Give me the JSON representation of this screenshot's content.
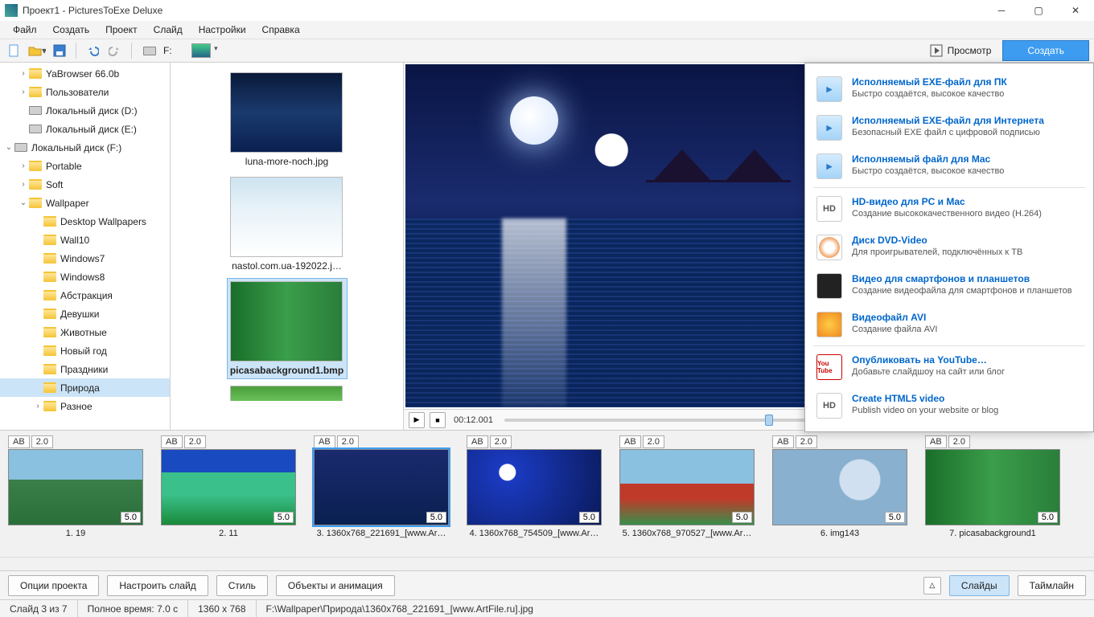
{
  "title": "Проект1 - PicturesToExe Deluxe",
  "menu": [
    "Файл",
    "Создать",
    "Проект",
    "Слайд",
    "Настройки",
    "Справка"
  ],
  "toolbar": {
    "drive_label": "F:",
    "preview": "Просмотр",
    "create": "Создать"
  },
  "tree": [
    {
      "indent": 1,
      "twisty": ">",
      "icon": "folder",
      "label": "YaBrowser 66.0b"
    },
    {
      "indent": 1,
      "twisty": ">",
      "icon": "folder",
      "label": "Пользователи"
    },
    {
      "indent": 1,
      "twisty": "",
      "icon": "drive",
      "label": "Локальный диск (D:)"
    },
    {
      "indent": 1,
      "twisty": "",
      "icon": "drive",
      "label": "Локальный диск (E:)"
    },
    {
      "indent": 0,
      "twisty": "v",
      "icon": "drive",
      "label": "Локальный диск (F:)"
    },
    {
      "indent": 1,
      "twisty": ">",
      "icon": "folder",
      "label": "Portable"
    },
    {
      "indent": 1,
      "twisty": ">",
      "icon": "folder",
      "label": "Soft"
    },
    {
      "indent": 1,
      "twisty": "v",
      "icon": "folder",
      "label": "Wallpaper"
    },
    {
      "indent": 2,
      "twisty": "",
      "icon": "folder",
      "label": "Desktop Wallpapers"
    },
    {
      "indent": 2,
      "twisty": "",
      "icon": "folder",
      "label": "Wall10"
    },
    {
      "indent": 2,
      "twisty": "",
      "icon": "folder",
      "label": "Windows7"
    },
    {
      "indent": 2,
      "twisty": "",
      "icon": "folder",
      "label": "Windows8"
    },
    {
      "indent": 2,
      "twisty": "",
      "icon": "folder",
      "label": "Абстракция"
    },
    {
      "indent": 2,
      "twisty": "",
      "icon": "folder",
      "label": "Девушки"
    },
    {
      "indent": 2,
      "twisty": "",
      "icon": "folder",
      "label": "Животные"
    },
    {
      "indent": 2,
      "twisty": "",
      "icon": "folder",
      "label": "Новый год"
    },
    {
      "indent": 2,
      "twisty": "",
      "icon": "folder",
      "label": "Праздники"
    },
    {
      "indent": 2,
      "twisty": "",
      "icon": "folder",
      "label": "Природа",
      "selected": true
    },
    {
      "indent": 2,
      "twisty": ">",
      "icon": "folder",
      "label": "Разное"
    }
  ],
  "thumbs": [
    {
      "name": "luna-more-noch.jpg",
      "bg": "linear-gradient(#0a1a3a,#1a3a6e 50%,#0a2050)"
    },
    {
      "name": "nastol.com.ua-192022.j…",
      "bg": "linear-gradient(#cde4f0,#e8f2f8 40%,#fff)"
    },
    {
      "name": "picasabackground1.bmp",
      "bg": "linear-gradient(90deg,#1a6e2a,#3a9e4a,#2a7e3a)",
      "selected": true
    },
    {
      "name": "",
      "bg": "linear-gradient(#4a9e3a,#6ac05a)",
      "partial": true
    }
  ],
  "playbar": {
    "time": "00:12.001"
  },
  "export": [
    {
      "icon": "play",
      "title": "Исполняемый EXE-файл для ПК",
      "sub": "Быстро создаётся, высокое качество"
    },
    {
      "icon": "play",
      "title": "Исполняемый EXE-файл для Интернета",
      "sub": "Безопасный EXE файл с цифровой подписью"
    },
    {
      "icon": "play",
      "title": "Исполняемый файл для Mac",
      "sub": "Быстро создаётся, высокое качество"
    },
    {
      "sep": true
    },
    {
      "icon": "hd",
      "title": "HD-видео для PC и Mac",
      "sub": "Создание высококачественного видео (H.264)"
    },
    {
      "icon": "dvd",
      "title": "Диск DVD-Video",
      "sub": "Для проигрывателей, подключённых к ТВ"
    },
    {
      "icon": "dev",
      "title": "Видео для смартфонов и планшетов",
      "sub": "Создание видеофайла для смартфонов и планшетов"
    },
    {
      "icon": "avi",
      "title": "Видеофайл AVI",
      "sub": "Создание файла AVI"
    },
    {
      "sep": true
    },
    {
      "icon": "yt",
      "title": "Опубликовать на YouTube…",
      "sub": "Добавьте слайдшоу на сайт или блог"
    },
    {
      "icon": "hd",
      "title": "Create HTML5 video",
      "sub": "Publish video on your website or blog"
    }
  ],
  "slides": [
    {
      "ab": "AB",
      "t": "2.0",
      "dur": "5.0",
      "cap": "1. 19",
      "bg": "linear-gradient(#8ac0e0 40%,#3a7e4a 40%,#2a6e3a)"
    },
    {
      "ab": "AB",
      "t": "2.0",
      "dur": "5.0",
      "cap": "2. 11",
      "bg": "linear-gradient(#1a4ac0 30%,#3ac08a 30% 60%,#1a8a3a)"
    },
    {
      "ab": "AB",
      "t": "2.0",
      "dur": "5.0",
      "cap": "3. 1360x768_221691_[www.Ar…",
      "bg": "linear-gradient(#1a2a6e,#0a2050)",
      "selected": true
    },
    {
      "ab": "AB",
      "t": "2.0",
      "dur": "5.0",
      "cap": "4. 1360x768_754509_[www.Ar…",
      "bg": "radial-gradient(circle at 30% 30%,#fff 0 10px,#1a3ac0 11px,#0a1a5a)"
    },
    {
      "ab": "AB",
      "t": "2.0",
      "dur": "5.0",
      "cap": "5. 1360x768_970527_[www.Ar…",
      "bg": "linear-gradient(#8ac0e0 45%,#c03a2a 45% 65%,#3a8e4a)"
    },
    {
      "ab": "AB",
      "t": "2.0",
      "dur": "5.0",
      "cap": "6. img143",
      "bg": "radial-gradient(circle at 65% 40%,#d0e0f0 0 25px,#8ab0d0 26px),linear-gradient(#b0c8e0,#e0e8f0)"
    },
    {
      "ab": "AB",
      "t": "2.0",
      "dur": "5.0",
      "cap": "7. picasabackground1",
      "bg": "linear-gradient(90deg,#1a6e2a,#3a9e4a,#2a7e3a)"
    }
  ],
  "bottom": {
    "opts": "Опции проекта",
    "slide": "Настроить слайд",
    "style": "Стиль",
    "obj": "Объекты и анимация",
    "slides": "Слайды",
    "timeline": "Таймлайн"
  },
  "status": {
    "s1": "Слайд 3 из 7",
    "s2": "Полное время: 7.0 с",
    "s3": "1360 x 768",
    "s4": "F:\\Wallpaper\\Природа\\1360x768_221691_[www.ArtFile.ru].jpg"
  }
}
